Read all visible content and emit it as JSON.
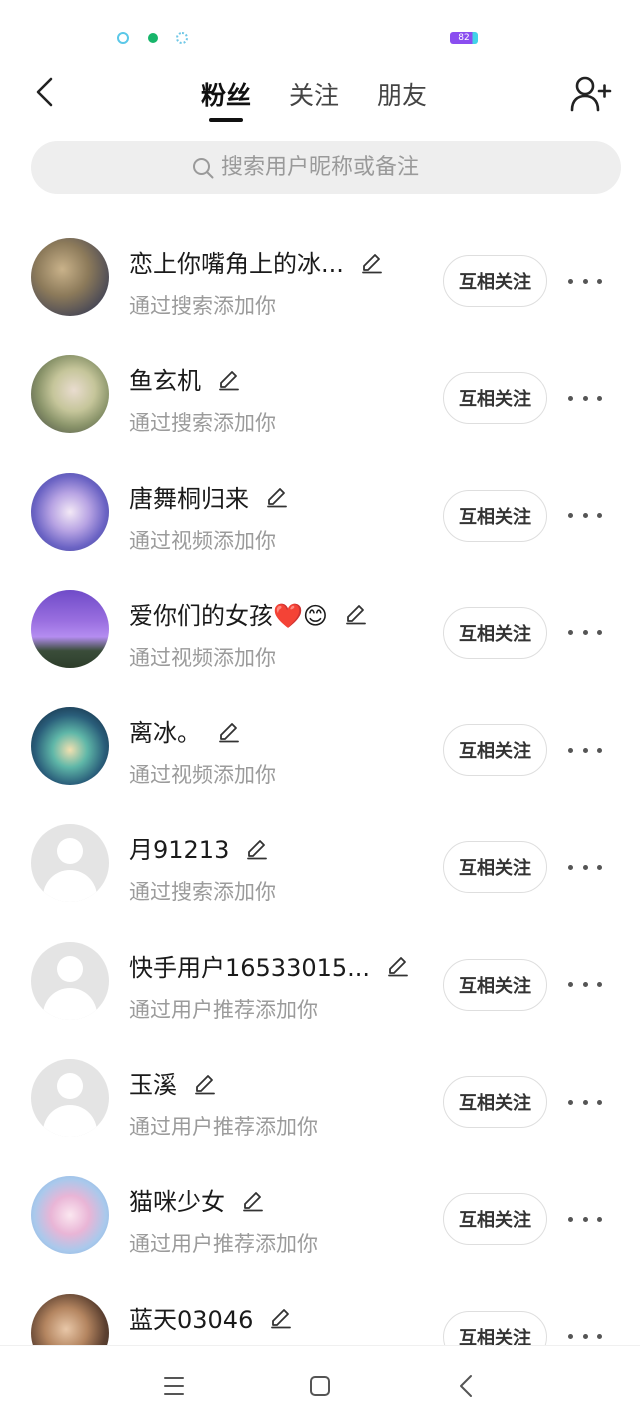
{
  "status_bar": {
    "battery": "82"
  },
  "header": {
    "tabs": [
      {
        "label": "粉丝",
        "active": true
      },
      {
        "label": "关注",
        "active": false
      },
      {
        "label": "朋友",
        "active": false
      }
    ]
  },
  "search": {
    "placeholder": "搜索用户昵称或备注"
  },
  "list": {
    "rows": [
      {
        "name": "恋上你嘴角上的冰...",
        "source": "通过搜索添加你",
        "button": "互相关注",
        "avatar": "photo"
      },
      {
        "name": "鱼玄机",
        "source": "通过搜索添加你",
        "button": "互相关注",
        "avatar": "photo"
      },
      {
        "name": "唐舞桐归来",
        "source": "通过视频添加你",
        "button": "互相关注",
        "avatar": "photo"
      },
      {
        "name": "爱你们的女孩❤️😊",
        "source": "通过视频添加你",
        "button": "互相关注",
        "avatar": "photo"
      },
      {
        "name": "离冰。",
        "source": "通过视频添加你",
        "button": "互相关注",
        "avatar": "photo"
      },
      {
        "name": "月91213",
        "source": "通过搜索添加你",
        "button": "互相关注",
        "avatar": "default"
      },
      {
        "name": "快手用户16533015...",
        "source": "通过用户推荐添加你",
        "button": "互相关注",
        "avatar": "default"
      },
      {
        "name": "玉溪",
        "source": "通过用户推荐添加你",
        "button": "互相关注",
        "avatar": "default"
      },
      {
        "name": "猫咪少女",
        "source": "通过用户推荐添加你",
        "button": "互相关注",
        "avatar": "photo"
      },
      {
        "name": "蓝天03046",
        "source": "",
        "button": "互相关注",
        "avatar": "photo"
      }
    ]
  },
  "colors": {
    "accent": "#111111",
    "muted": "#9b9b9b",
    "search_bg": "#eeeeee"
  },
  "icons": [
    "back-icon",
    "add-user-icon",
    "search-icon",
    "edit-icon",
    "more-icon",
    "menu-icon",
    "home-icon",
    "nav-back-icon"
  ]
}
